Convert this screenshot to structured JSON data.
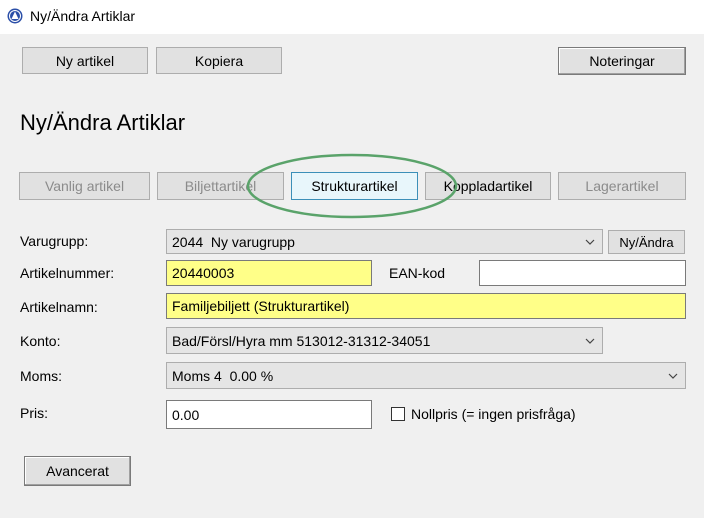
{
  "window": {
    "title": "Ny/Ändra Artiklar"
  },
  "toolbar": {
    "new_label": "Ny artikel",
    "copy_label": "Kopiera",
    "notes_label": "Noteringar"
  },
  "page": {
    "heading": "Ny/Ändra Artiklar"
  },
  "article_types": [
    {
      "label": "Vanlig artikel",
      "state": "disabled"
    },
    {
      "label": "Biljettartikel",
      "state": "disabled"
    },
    {
      "label": "Strukturartikel",
      "state": "selected"
    },
    {
      "label": "Koppladartikel",
      "state": "enabled"
    },
    {
      "label": "Lagerartikel",
      "state": "disabled"
    }
  ],
  "form": {
    "varugrupp": {
      "label": "Varugrupp:",
      "value": "2044  Ny varugrupp",
      "button": "Ny/Ändra"
    },
    "artikelnummer": {
      "label": "Artikelnummer:",
      "value": "20440003"
    },
    "ean": {
      "label": "EAN-kod",
      "value": ""
    },
    "artikelnamn": {
      "label": "Artikelnamn:",
      "value": "Familjebiljett (Strukturartikel)"
    },
    "konto": {
      "label": "Konto:",
      "value": "Bad/Försl/Hyra mm 513012-31312-34051"
    },
    "moms": {
      "label": "Moms:",
      "value": "Moms 4  0.00 %"
    },
    "pris": {
      "label": "Pris:",
      "value": "0.00"
    },
    "nollpris": {
      "label": "Nollpris (= ingen prisfråga)",
      "checked": false
    }
  },
  "advanced_label": "Avancerat",
  "colors": {
    "required_field": "#ffff88",
    "selected_type": "#e8f6fb",
    "annotation_ring": "#5aa36a"
  }
}
